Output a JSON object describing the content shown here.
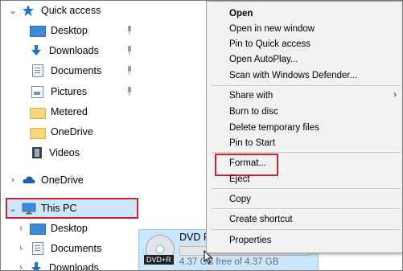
{
  "nav": {
    "quick_access": "Quick access",
    "quick_items": [
      {
        "label": "Desktop",
        "pinned": true,
        "icon": "desktop-icon"
      },
      {
        "label": "Downloads",
        "pinned": true,
        "icon": "downloads-icon"
      },
      {
        "label": "Documents",
        "pinned": true,
        "icon": "documents-icon"
      },
      {
        "label": "Pictures",
        "pinned": true,
        "icon": "pictures-icon"
      },
      {
        "label": "Metered",
        "pinned": false,
        "icon": "folder-icon"
      },
      {
        "label": "OneDrive",
        "pinned": false,
        "icon": "folder-icon"
      },
      {
        "label": "Videos",
        "pinned": false,
        "icon": "videos-icon"
      }
    ],
    "onedrive": "OneDrive",
    "this_pc": "This PC",
    "this_pc_items": [
      {
        "label": "Desktop",
        "icon": "desktop-icon"
      },
      {
        "label": "Documents",
        "icon": "documents-icon"
      },
      {
        "label": "Downloads",
        "icon": "downloads-icon"
      }
    ]
  },
  "drive": {
    "name": "DVD RW Drive",
    "badge": "DVD+R",
    "free_text": "4.37 GB free of 4.37 GB",
    "used_fraction": 0.0
  },
  "context_menu": {
    "items": [
      {
        "label": "Open",
        "bold": true
      },
      {
        "label": "Open in new window"
      },
      {
        "label": "Pin to Quick access"
      },
      {
        "label": "Open AutoPlay..."
      },
      {
        "label": "Scan with Windows Defender..."
      },
      {
        "label": "Share with",
        "submenu": true
      },
      {
        "label": "Burn to disc"
      },
      {
        "label": "Delete temporary files"
      },
      {
        "label": "Pin to Start"
      },
      {
        "label": "Format..."
      },
      {
        "label": "Eject"
      },
      {
        "label": "Copy"
      },
      {
        "label": "Create shortcut"
      },
      {
        "label": "Properties"
      }
    ],
    "submenu_glyph": "›"
  },
  "colors": {
    "highlight": "#cce6fb",
    "annotation_red": "#d0222a",
    "accent_blue": "#1e76c8"
  }
}
